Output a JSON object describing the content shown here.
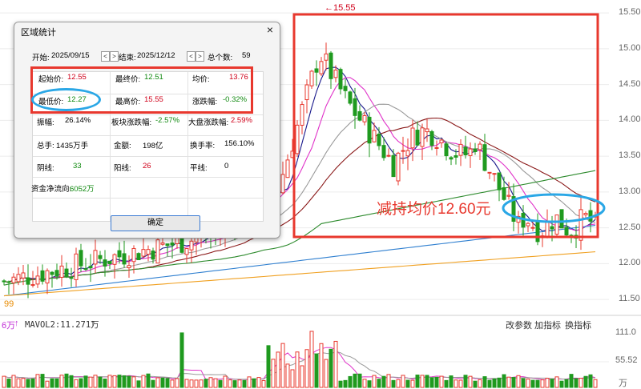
{
  "chart_data": {
    "type": "candlestick",
    "price_axis_ticks": [
      "15.50",
      "15.00",
      "14.50",
      "14.00",
      "13.50",
      "13.00",
      "12.50",
      "12.00",
      "11.50"
    ],
    "price_axis_range": [
      11.3,
      15.68
    ],
    "high_marker": "←15.55",
    "low_tick": "99",
    "volume_axis_ticks": [
      "111.0",
      "55.52",
      "万"
    ],
    "volume_axis_range": [
      0,
      111.0
    ],
    "volume_legend": "6万",
    "volume_ma_label": "MAVOL2:11.271万",
    "moving_average_colors": [
      "#1a1a8c",
      "#e033c9",
      "#9a9a9a",
      "#8b1a1a",
      "#2e8b2e",
      "#2f7fd0",
      "#f0a020"
    ]
  },
  "toolbar": {
    "items": [
      "改参数",
      "加指标",
      "换指标"
    ]
  },
  "dialog": {
    "title": "区域统计",
    "close": "×",
    "start_label": "开始:",
    "start_date": "2025/09/15",
    "end_label": "结束:",
    "end_date": "2025/12/12",
    "total_label": "总个数:",
    "total_value": "59",
    "nav_prev": "<",
    "nav_next": ">",
    "stats": {
      "open_label": "起始价:",
      "open_value": "12.55",
      "close_label": "最终价:",
      "close_value": "12.51",
      "avg_label": "均价:",
      "avg_value": "13.76",
      "low_label": "最低价:",
      "low_value": "12.27",
      "high_label": "最高价:",
      "high_value": "15.55",
      "change_label": "涨跌幅:",
      "change_value": "-0.32%",
      "amp_label": "振幅:",
      "amp_value": "26.14%",
      "sector_label": "板块涨跌幅:",
      "sector_value": "-2.57%",
      "market_label": "大盘涨跌幅:",
      "market_value": "2.59%",
      "vol_label": "总手:",
      "vol_value": "1435万手",
      "amount_label": "金额:",
      "amount_value": "198亿",
      "turnover_label": "换手率:",
      "turnover_value": "156.10%",
      "yin_label": "阴线:",
      "yin_value": "33",
      "yang_label": "阳线:",
      "yang_value": "26",
      "flat_label": "平线:",
      "flat_value": "0",
      "netflow_label": "资金净流向:",
      "netflow_value": "6052万"
    },
    "ok_button": "确定"
  },
  "annotation": {
    "text": "减持均价12.60元"
  },
  "colors": {
    "up": "#e8382e",
    "down": "#1f9a1f",
    "annotation_red": "#e8382e",
    "annotation_blue": "#2aa7e6"
  }
}
